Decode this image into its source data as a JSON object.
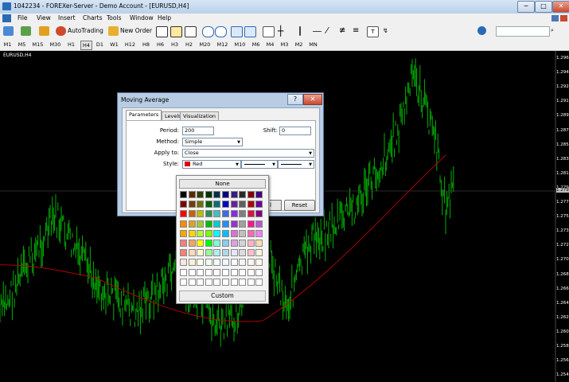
{
  "window": {
    "title": "1042234 - FOREXer-Server - Demo Account - [EURUSD,H4]",
    "minimize": "─",
    "maximize": "□",
    "close": "✕"
  },
  "menu": [
    "File",
    "View",
    "Insert",
    "Charts",
    "Tools",
    "Window",
    "Help"
  ],
  "toolbar": {
    "autotrading": "AutoTrading",
    "new_order": "New Order",
    "search_placeholder": ""
  },
  "timeframes": [
    "M1",
    "M5",
    "M15",
    "M30",
    "H1",
    "H4",
    "D1",
    "W1",
    "H12",
    "H8",
    "H6",
    "H3",
    "H2",
    "M20",
    "M12",
    "M10",
    "M6",
    "M4",
    "M3",
    "M2",
    "MN"
  ],
  "active_timeframe": "H4",
  "chart": {
    "symbol": "EURUSD,H4",
    "price_labels": [
      "1.296",
      "1.294",
      "1.292",
      "1.291",
      "1.289",
      "1.287",
      "1.285",
      "1.283",
      "1.281",
      "1.279",
      "1.277",
      "1.275",
      "1.273",
      "1.272",
      "1.270",
      "1.268",
      "1.266",
      "1.264",
      "1.262",
      "1.260",
      "1.258",
      "1.256",
      "1.254"
    ],
    "current_price": "1.279"
  },
  "dialog": {
    "title": "Moving Average",
    "help": "?",
    "close": "✕",
    "tabs": [
      "Parameters",
      "Levels",
      "Visualization"
    ],
    "period_label": "Period:",
    "period_value": "200",
    "shift_label": "Shift:",
    "shift_value": "0",
    "method_label": "Method:",
    "method_value": "Simple",
    "apply_label": "Apply to:",
    "apply_value": "Close",
    "style_label": "Style:",
    "style_value": "Red",
    "ok_fragment": "l",
    "reset": "Reset"
  },
  "color_popup": {
    "none": "None",
    "custom": "Custom",
    "colors": [
      "#000000",
      "#5a2a00",
      "#2f3f00",
      "#003200",
      "#00304a",
      "#000080",
      "#3a1c7a",
      "#2a2a2a",
      "#800000",
      "#400080",
      "#800000",
      "#7a3a00",
      "#707000",
      "#006400",
      "#00707a",
      "#0000c8",
      "#6a1f9f",
      "#606060",
      "#b40000",
      "#6a009f",
      "#ff0000",
      "#c86400",
      "#bdbd00",
      "#2e8b57",
      "#40c0c0",
      "#4169e1",
      "#8a2be2",
      "#808080",
      "#dc143c",
      "#800080",
      "#ff8c00",
      "#daa520",
      "#9acd32",
      "#00c000",
      "#00ced1",
      "#1e90ff",
      "#9932cc",
      "#a0a0a0",
      "#ff1493",
      "#ba55d3",
      "#ffa500",
      "#ffd700",
      "#adff2f",
      "#7cfc00",
      "#00ffff",
      "#00bfff",
      "#da70d6",
      "#c0c0c0",
      "#ff69b4",
      "#ee82ee",
      "#f08080",
      "#f4a460",
      "#ffff00",
      "#00ff00",
      "#7fffd4",
      "#87ceeb",
      "#dda0dd",
      "#d3d3d3",
      "#ffb6c1",
      "#f5deb3",
      "#fa8072",
      "#ffdab9",
      "#fffacd",
      "#98fb98",
      "#afeeee",
      "#add8e6",
      "#e6e6fa",
      "#dcdcdc",
      "#ffc0cb",
      "#f5f5dc",
      "#ffe4e1",
      "#ffefd5",
      "#fffff0",
      "#f0fff0",
      "#f0ffff",
      "#f0f8ff",
      "#f8f8ff",
      "#f5f5f5",
      "#fff5ee",
      "#fffaf0",
      "#ffffff",
      "#ffffff",
      "#ffffff",
      "#ffffff",
      "#ffffff",
      "#ffffff",
      "#ffffff",
      "#ffffff",
      "#ffffff",
      "#ffffff",
      "#ffffff",
      "#ffffff",
      "#ffffff",
      "#ffffff",
      "#ffffff",
      "#ffffff",
      "#ffffff",
      "#ffffff",
      "#ffffff",
      "#ffffff"
    ]
  },
  "colors": {
    "candles": "#00b000",
    "ma_line": "#c00000",
    "accent": "#2a6bb5"
  }
}
